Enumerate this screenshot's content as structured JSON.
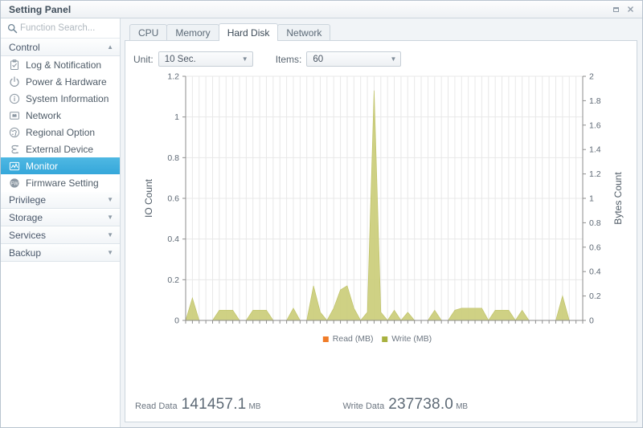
{
  "window": {
    "title": "Setting Panel",
    "controls": [
      {
        "name": "restore-button",
        "glyph": "restore"
      },
      {
        "name": "close-button",
        "glyph": "close"
      }
    ]
  },
  "sidebar": {
    "search": {
      "placeholder": "Function Search...",
      "value": "",
      "icon": "search-icon"
    },
    "groups": [
      {
        "label": "Control",
        "expanded": true,
        "caret": "▲",
        "items": [
          {
            "label": "Log & Notification",
            "icon": "clipboard-check-icon",
            "selected": false
          },
          {
            "label": "Power & Hardware",
            "icon": "power-icon",
            "selected": false
          },
          {
            "label": "System Information",
            "icon": "info-circle-icon",
            "selected": false
          },
          {
            "label": "Network",
            "icon": "network-card-icon",
            "selected": false
          },
          {
            "label": "Regional Option",
            "icon": "globe-icon",
            "selected": false
          },
          {
            "label": "External Device",
            "icon": "usb-icon",
            "selected": false
          },
          {
            "label": "Monitor",
            "icon": "chart-monitor-icon",
            "selected": true
          },
          {
            "label": "Firmware Setting",
            "icon": "firmware-icon",
            "selected": false
          }
        ]
      },
      {
        "label": "Privilege",
        "expanded": false,
        "caret": "▼",
        "items": []
      },
      {
        "label": "Storage",
        "expanded": false,
        "caret": "▼",
        "items": []
      },
      {
        "label": "Services",
        "expanded": false,
        "caret": "▼",
        "items": []
      },
      {
        "label": "Backup",
        "expanded": false,
        "caret": "▼",
        "items": []
      }
    ]
  },
  "main": {
    "tabs": [
      {
        "label": "CPU",
        "active": false
      },
      {
        "label": "Memory",
        "active": false
      },
      {
        "label": "Hard Disk",
        "active": true
      },
      {
        "label": "Network",
        "active": false
      }
    ],
    "toolbar": {
      "unit_label": "Unit:",
      "unit_value": "10 Sec.",
      "unit_caret": "▼",
      "items_label": "Items:",
      "items_value": "60",
      "items_caret": "▼"
    },
    "stats": {
      "read_label": "Read Data",
      "read_value": "141457.1",
      "read_unit": "MB",
      "write_label": "Write Data",
      "write_value": "237738.0",
      "write_unit": "MB"
    }
  },
  "chart_data": {
    "type": "area",
    "title": "",
    "xlabel": "",
    "ylabel": "IO Count",
    "y2label": "Bytes Count",
    "ylim": [
      0,
      1.2
    ],
    "y2lim": [
      0,
      2
    ],
    "yticks": [
      "0",
      "0.2",
      "0.4",
      "0.6",
      "0.8",
      "1",
      "1.2"
    ],
    "ytick_values": [
      0,
      0.2,
      0.4,
      0.6,
      0.8,
      1,
      1.2
    ],
    "y2ticks": [
      "0",
      "0.2",
      "0.4",
      "0.6",
      "0.8",
      "1",
      "1.2",
      "1.4",
      "1.6",
      "1.8",
      "2"
    ],
    "y2tick_values": [
      0,
      0.2,
      0.4,
      0.6,
      0.8,
      1,
      1.2,
      1.4,
      1.6,
      1.8,
      2
    ],
    "grid": true,
    "grid_vertical": true,
    "x_count": 60,
    "legend_position": "bottom",
    "colors": {
      "read": "#f07c28",
      "write": "#cccf7d",
      "write_line": "#bfc268",
      "grid": "#e8e8e8",
      "axis": "#8e8e8e"
    },
    "series": [
      {
        "name": "Read (MB)",
        "axis": "left",
        "color": "#f07c28",
        "values": [
          0,
          0,
          0,
          0,
          0,
          0,
          0,
          0,
          0,
          0,
          0,
          0,
          0,
          0,
          0,
          0,
          0,
          0,
          0,
          0,
          0,
          0,
          0,
          0,
          0,
          0,
          0,
          0,
          0,
          0,
          0,
          0,
          0,
          0,
          0,
          0,
          0,
          0,
          0,
          0,
          0,
          0,
          0,
          0,
          0,
          0,
          0,
          0,
          0,
          0,
          0,
          0,
          0,
          0,
          0,
          0,
          0,
          0,
          0,
          0
        ]
      },
      {
        "name": "Write (MB)",
        "axis": "left",
        "color": "#cccf7d",
        "values": [
          0,
          0.11,
          0,
          0,
          0,
          0.05,
          0.05,
          0.05,
          0,
          0,
          0.05,
          0.05,
          0.05,
          0,
          0,
          0,
          0.06,
          0,
          0,
          0.17,
          0.04,
          0,
          0.06,
          0.15,
          0.17,
          0.06,
          0,
          0.04,
          1.13,
          0.04,
          0,
          0.05,
          0,
          0.04,
          0,
          0,
          0,
          0.05,
          0,
          0,
          0.05,
          0.06,
          0.06,
          0.06,
          0.06,
          0,
          0.05,
          0.05,
          0.05,
          0,
          0.05,
          0,
          0,
          0,
          0,
          0,
          0.12,
          0,
          0,
          0
        ]
      }
    ],
    "legend": [
      {
        "label": "Read (MB)",
        "color": "#f07c28"
      },
      {
        "label": "Write (MB)",
        "color": "#a8b13f"
      }
    ]
  }
}
